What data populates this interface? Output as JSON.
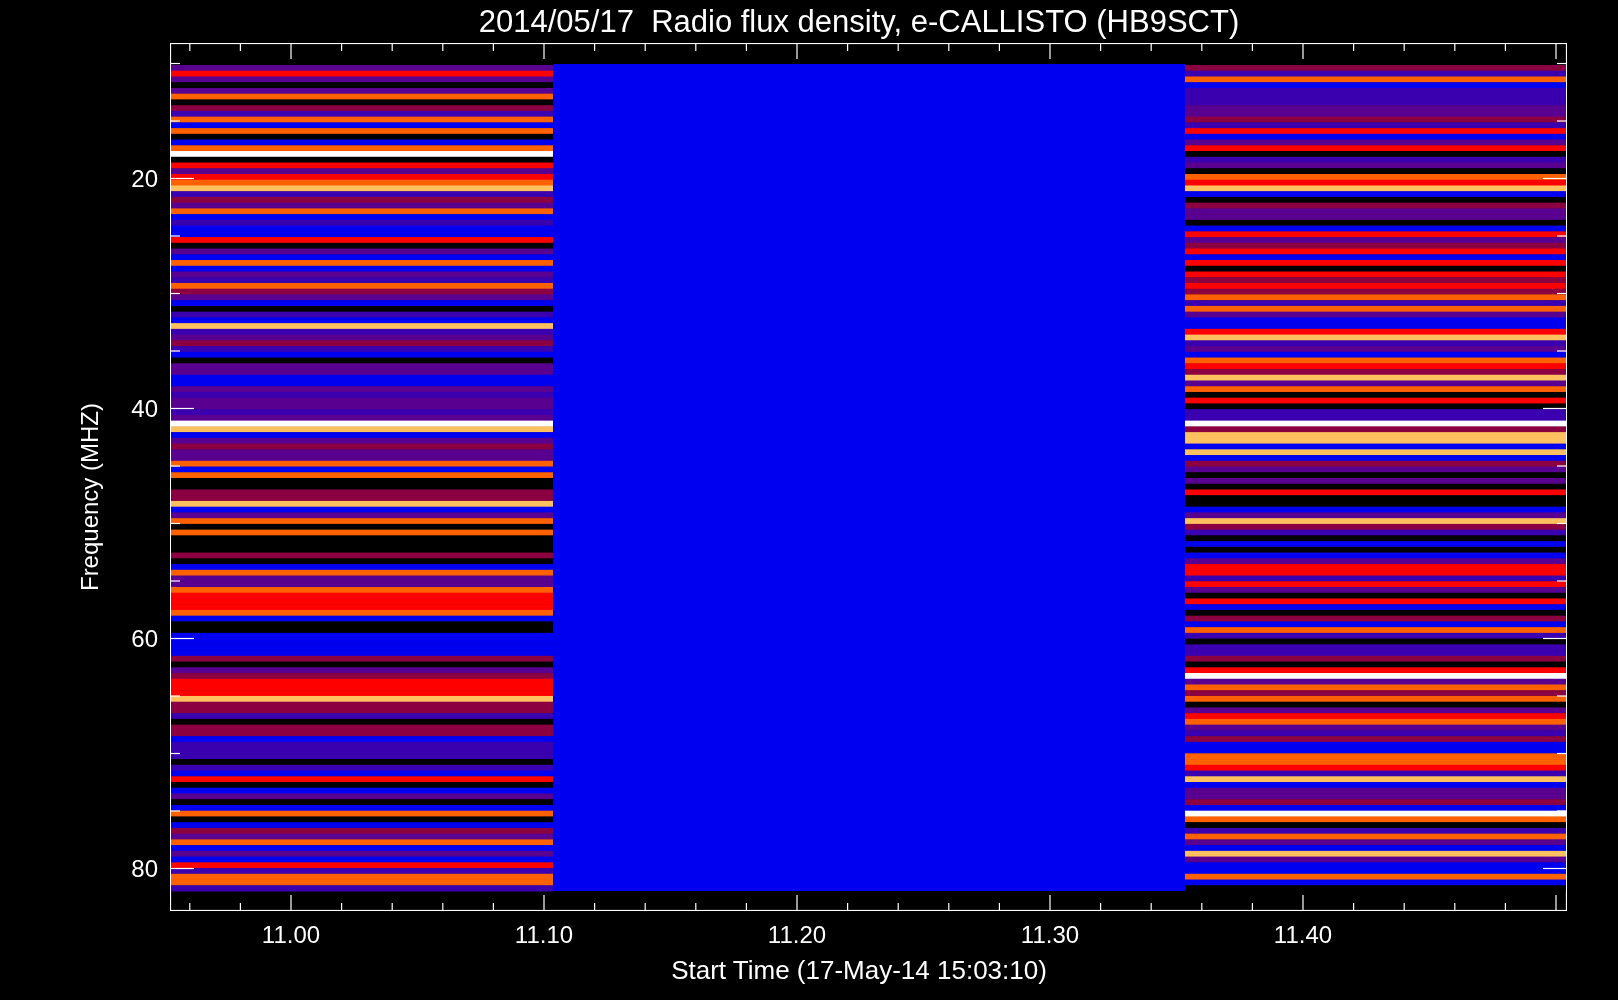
{
  "title": "2014/05/17  Radio flux density, e-CALLISTO (HB9SCT)",
  "y_axis": {
    "label": "Frequency (MHZ)",
    "ticks": [
      "20",
      "40",
      "60",
      "80"
    ]
  },
  "x_axis": {
    "label": "Start Time (17-May-14 15:03:10)",
    "ticks": [
      "11.00",
      "11.10",
      "11.20",
      "11.30",
      "11.40"
    ]
  }
}
